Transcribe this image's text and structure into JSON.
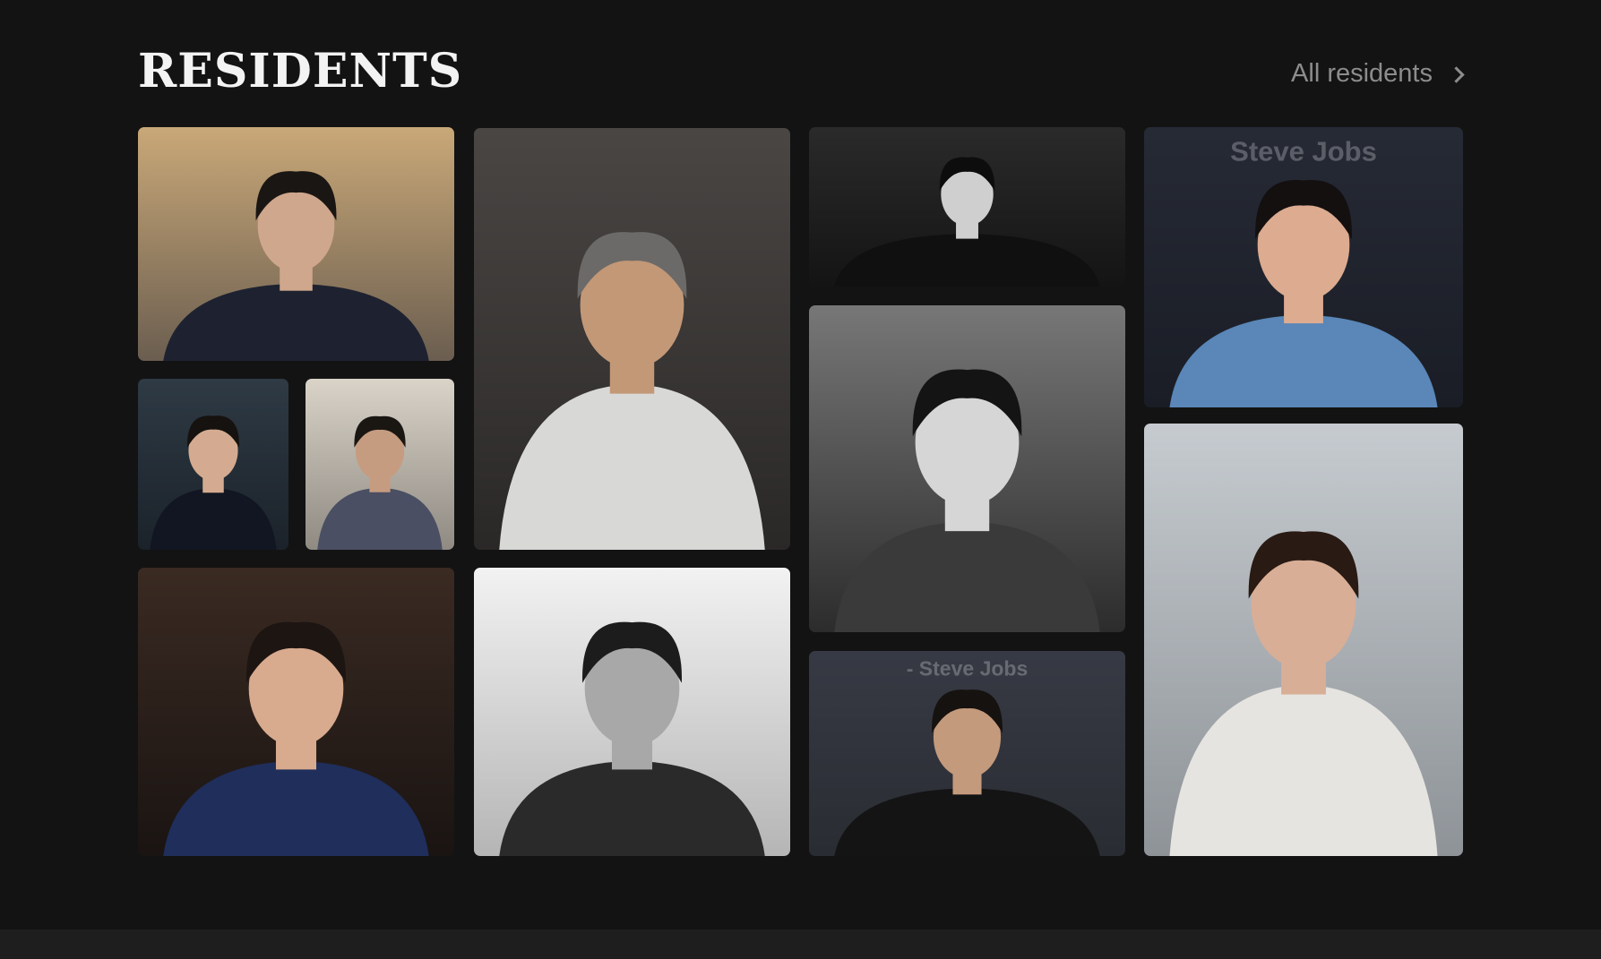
{
  "header": {
    "title": "RESIDENTS",
    "all_link_label": "All residents"
  },
  "tiles": [
    {
      "name": "resident-photo-1",
      "bg_top": "#c9a878",
      "bg_bottom": "#6b5e50",
      "suit": "#1e2230",
      "skin": "#cfa78c",
      "hair": "#1a1614",
      "mono": false
    },
    {
      "name": "resident-photo-2",
      "bg_top": "#2e3a44",
      "bg_bottom": "#1b222a",
      "suit": "#111622",
      "skin": "#d4ab90",
      "hair": "#15120f",
      "mono": false
    },
    {
      "name": "resident-photo-3",
      "bg_top": "#d9d3c8",
      "bg_bottom": "#8f8a82",
      "suit": "#4a4f63",
      "skin": "#c59c80",
      "hair": "#1a1612",
      "mono": false
    },
    {
      "name": "resident-photo-4",
      "bg_top": "#4a4644",
      "bg_bottom": "#2a2827",
      "suit": "#d8d8d6",
      "skin": "#c39877",
      "hair": "#6c6a68",
      "mono": false
    },
    {
      "name": "resident-photo-5",
      "bg_top": "#3a2a22",
      "bg_bottom": "#1a1412",
      "suit": "#1f2e5a",
      "skin": "#d8aa8e",
      "hair": "#1d1512",
      "mono": false
    },
    {
      "name": "resident-photo-6",
      "bg_top": "#f2f2f2",
      "bg_bottom": "#b5b5b5",
      "suit": "#2a2a2a",
      "skin": "#a8a8a8",
      "hair": "#1c1c1c",
      "mono": true
    },
    {
      "name": "resident-photo-7",
      "bg_top": "#2a2a2a",
      "bg_bottom": "#141414",
      "suit": "#101010",
      "skin": "#cfcfcf",
      "hair": "#0d0d0d",
      "mono": true
    },
    {
      "name": "resident-photo-8",
      "bg_top": "#777777",
      "bg_bottom": "#2c2c2c",
      "suit": "#3a3a3a",
      "skin": "#d6d6d6",
      "hair": "#141414",
      "mono": true
    },
    {
      "name": "resident-photo-9",
      "bg_top": "#373a44",
      "bg_bottom": "#2a2c33",
      "suit": "#141414",
      "skin": "#c49a7c",
      "hair": "#161210",
      "mono": false,
      "watermark": "- Steve Jobs"
    },
    {
      "name": "resident-photo-10",
      "bg_top": "#262a35",
      "bg_bottom": "#1a1d25",
      "suit": "#5a86b8",
      "skin": "#dcab90",
      "hair": "#141010",
      "mono": false,
      "watermark": "Steve Jobs"
    },
    {
      "name": "resident-photo-11",
      "bg_top": "#c6cbd0",
      "bg_bottom": "#8e9398",
      "suit": "#e6e4e0",
      "skin": "#d8ae96",
      "hair": "#2a1a14",
      "mono": false
    }
  ]
}
